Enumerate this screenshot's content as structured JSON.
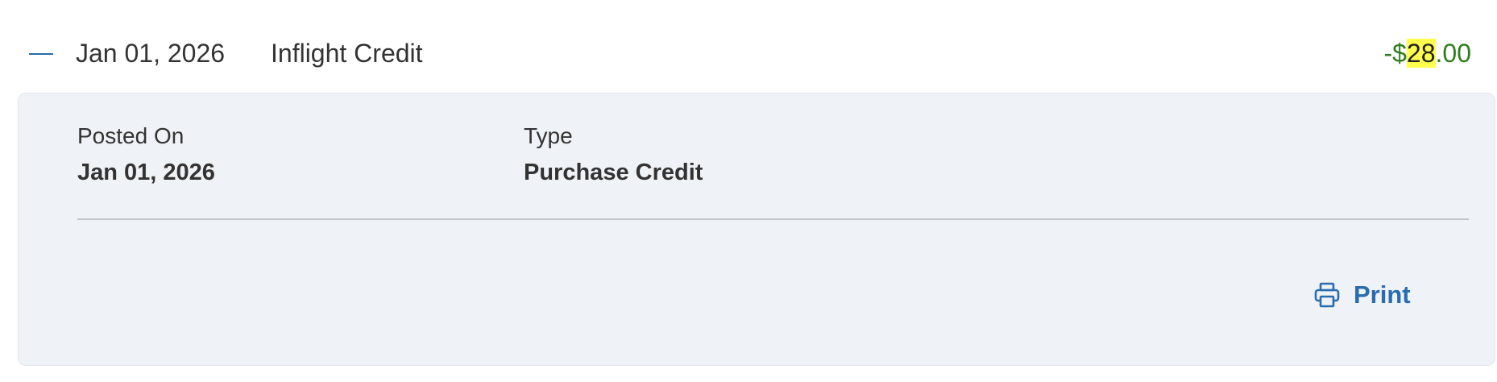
{
  "transaction": {
    "date": "Jan 01, 2026",
    "description": "Inflight Credit",
    "amount": {
      "prefix": "-$",
      "whole": "28",
      "cents": ".00"
    }
  },
  "details": {
    "posted_on_label": "Posted On",
    "posted_on_value": "Jan 01, 2026",
    "type_label": "Type",
    "type_value": "Purchase Credit"
  },
  "actions": {
    "print_label": "Print",
    "print_icon": "printer-icon"
  },
  "colors": {
    "accent": "#2a6cb0",
    "credit_amount": "#2f7d1c",
    "highlight": "#ffff4d",
    "panel_background": "#eff2f6"
  }
}
